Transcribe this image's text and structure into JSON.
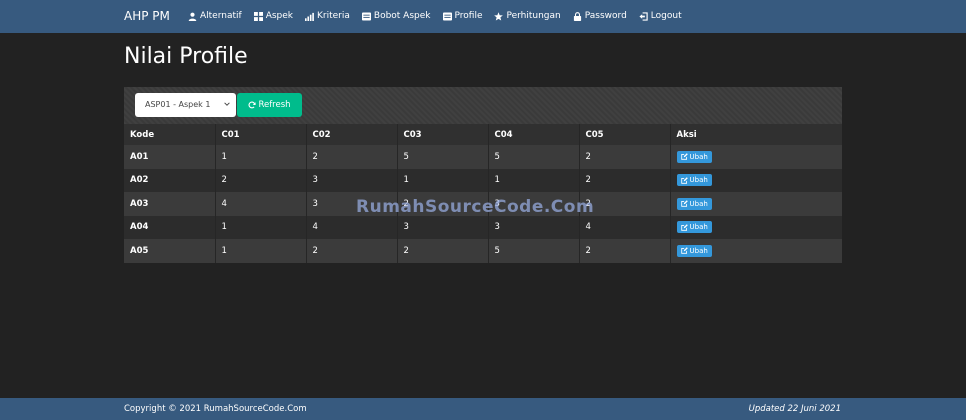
{
  "navbar": {
    "brand": "AHP PM",
    "items": [
      {
        "label": "Alternatif",
        "icon": "user-icon"
      },
      {
        "label": "Aspek",
        "icon": "grid-icon"
      },
      {
        "label": "Kriteria",
        "icon": "signal-icon"
      },
      {
        "label": "Bobot Aspek",
        "icon": "list-icon"
      },
      {
        "label": "Profile",
        "icon": "list-icon"
      },
      {
        "label": "Perhitungan",
        "icon": "star-icon"
      },
      {
        "label": "Password",
        "icon": "lock-icon"
      },
      {
        "label": "Logout",
        "icon": "logout-icon"
      }
    ]
  },
  "page": {
    "title": "Nilai Profile"
  },
  "toolbar": {
    "select_value": "ASP01 - Aspek 1",
    "refresh_label": "Refresh"
  },
  "table": {
    "headers": [
      "Kode",
      "C01",
      "C02",
      "C03",
      "C04",
      "C05",
      "Aksi"
    ],
    "rows": [
      {
        "kode": "A01",
        "values": [
          "1",
          "2",
          "5",
          "5",
          "2"
        ],
        "action": "Ubah"
      },
      {
        "kode": "A02",
        "values": [
          "2",
          "3",
          "1",
          "1",
          "2"
        ],
        "action": "Ubah"
      },
      {
        "kode": "A03",
        "values": [
          "4",
          "3",
          "2",
          "3",
          "2"
        ],
        "action": "Ubah"
      },
      {
        "kode": "A04",
        "values": [
          "1",
          "4",
          "3",
          "3",
          "4"
        ],
        "action": "Ubah"
      },
      {
        "kode": "A05",
        "values": [
          "1",
          "2",
          "2",
          "5",
          "2"
        ],
        "action": "Ubah"
      }
    ]
  },
  "watermark": "RumahSourceCode.Com",
  "footer": {
    "copyright": "Copyright © 2021 RumahSourceCode.Com",
    "updated": "Updated 22 Juni 2021"
  },
  "colors": {
    "navbar": "#375a7f",
    "success": "#00bc8c",
    "info": "#3498db",
    "background": "#222222"
  }
}
